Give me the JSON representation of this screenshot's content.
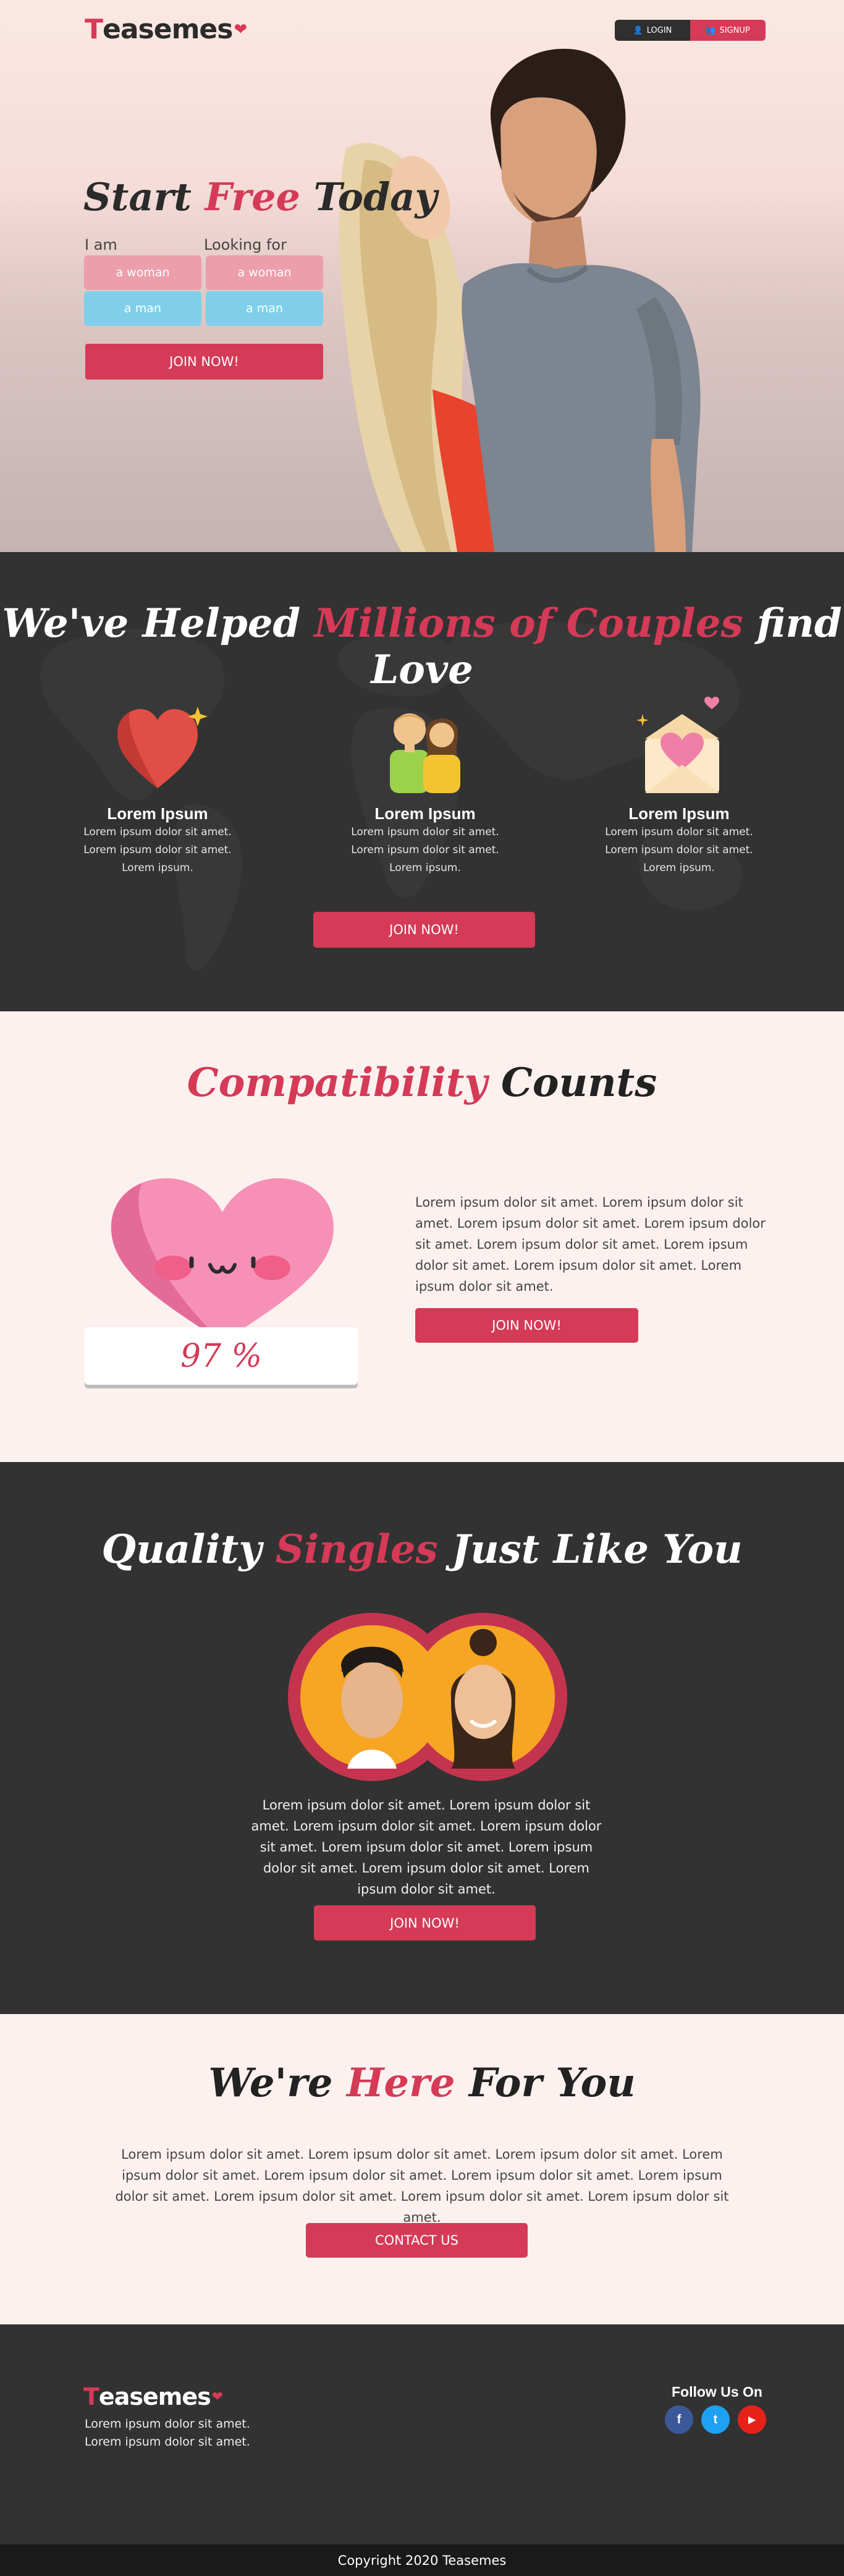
{
  "header": {
    "logo_letter": "T",
    "logo_rest": "easemes",
    "login_label": "LOGIN",
    "signup_label": "SIGNUP"
  },
  "hero": {
    "title_start": "Start",
    "title_accent": "Free",
    "title_end": "Today",
    "i_am_label": "I am",
    "looking_for_label": "Looking for",
    "iam_woman": "a woman",
    "iam_man": "a man",
    "look_woman": "a woman",
    "look_man": "a man",
    "join_label": "JOIN NOW!"
  },
  "helped": {
    "title_start": "We've Helped",
    "title_accent": "Millions of Couples",
    "title_end": "find Love",
    "features": [
      {
        "title": "Lorem Ipsum",
        "line1": "Lorem ipsum dolor sit amet.",
        "line2": "Lorem ipsum dolor sit amet.",
        "line3": "Lorem ipsum.",
        "icon": "heart-sparkle-icon"
      },
      {
        "title": "Lorem Ipsum",
        "line1": "Lorem ipsum dolor sit amet.",
        "line2": "Lorem ipsum dolor sit amet.",
        "line3": "Lorem ipsum.",
        "icon": "couple-avatars-icon"
      },
      {
        "title": "Lorem Ipsum",
        "line1": "Lorem ipsum dolor sit amet.",
        "line2": "Lorem ipsum dolor sit amet.",
        "line3": "Lorem ipsum.",
        "icon": "love-letter-icon"
      }
    ],
    "join_label": "JOIN NOW!"
  },
  "compat": {
    "title_accent": "Compatibility",
    "title_end": "Counts",
    "percent": "97 %",
    "text": "Lorem ipsum dolor sit amet. Lorem ipsum dolor sit amet. Lorem ipsum dolor sit amet. Lorem ipsum dolor sit amet. Lorem ipsum dolor sit amet. Lorem ipsum dolor sit amet. Lorem ipsum dolor sit amet. Lorem ipsum dolor sit amet.",
    "join_label": "JOIN NOW!"
  },
  "singles": {
    "title_start": "Quality",
    "title_accent": "Singles",
    "title_end": "Just Like You",
    "text": "Lorem ipsum dolor sit amet. Lorem ipsum dolor sit amet. Lorem ipsum dolor sit amet. Lorem ipsum dolor sit amet. Lorem ipsum dolor sit amet. Lorem ipsum dolor sit amet. Lorem ipsum dolor sit amet. Lorem ipsum dolor sit amet.",
    "join_label": "JOIN NOW!"
  },
  "here": {
    "title_start": "We're",
    "title_accent": "Here",
    "title_end": "For You",
    "text": "Lorem ipsum dolor sit amet. Lorem ipsum dolor sit amet. Lorem ipsum dolor sit amet. Lorem ipsum dolor sit amet. Lorem ipsum dolor sit amet. Lorem ipsum dolor sit amet. Lorem ipsum dolor sit amet. Lorem ipsum dolor sit amet. Lorem ipsum dolor sit amet. Lorem ipsum dolor sit amet.",
    "contact_label": "CONTACT US"
  },
  "footer": {
    "logo_letter": "T",
    "logo_rest": "easemes",
    "line1": "Lorem ipsum dolor sit amet.",
    "line2": "Lorem ipsum dolor sit amet.",
    "follow_label": "Follow Us On",
    "facebook": "f",
    "twitter": "t",
    "youtube": "▶",
    "copyright": "Copyright 2020 Teasemes"
  },
  "colors": {
    "accent": "#d53a57",
    "dark": "#323232",
    "light": "#fdf1ef",
    "facebook": "#3b5998",
    "twitter": "#1da1f2",
    "youtube": "#e62117"
  }
}
